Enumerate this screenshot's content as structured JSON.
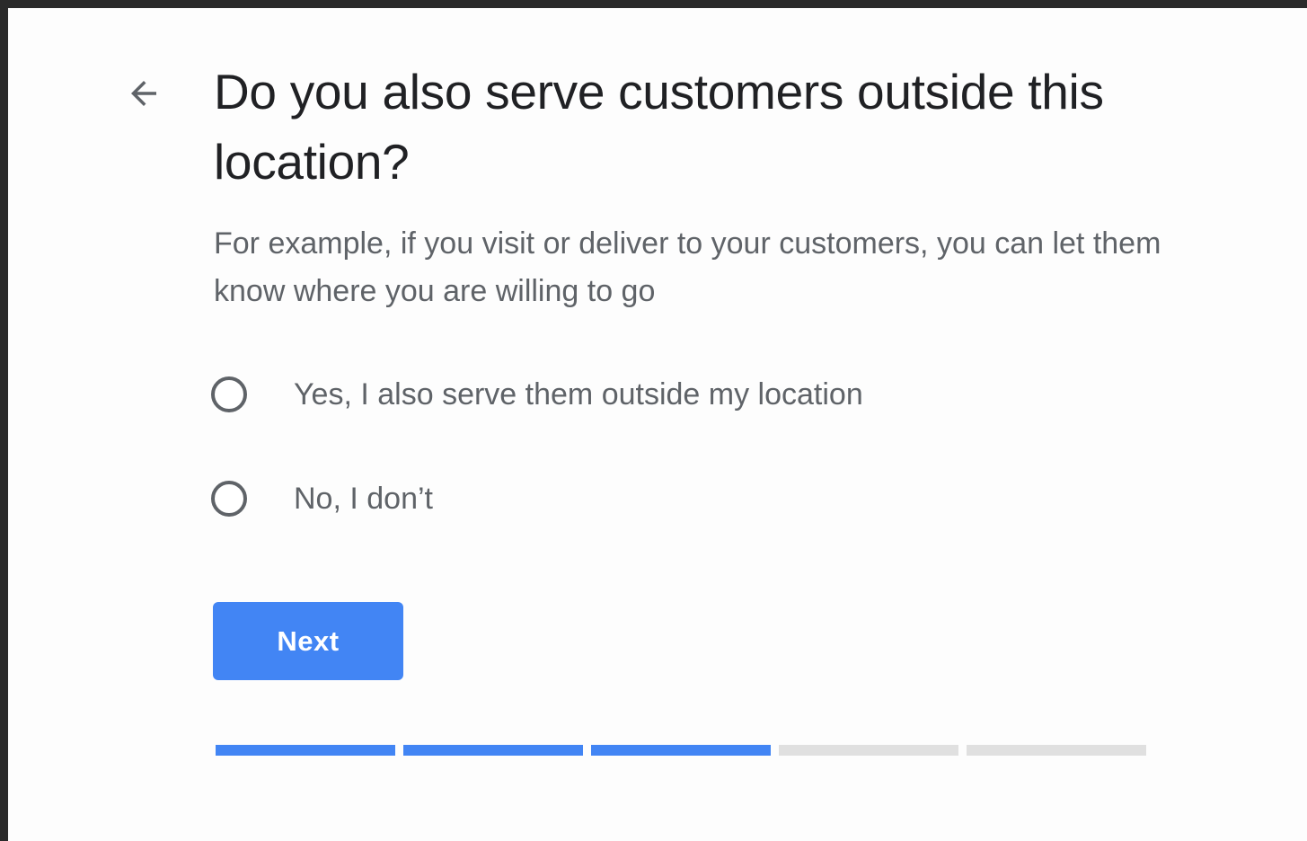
{
  "header": {
    "back_icon": "arrow-back-icon",
    "title": "Do you also serve customers outside this location?"
  },
  "subtitle": "For example, if you visit or deliver to your customers, you can let them know where you are willing to go",
  "options": [
    {
      "label": "Yes, I also serve them outside my location",
      "selected": false
    },
    {
      "label": "No, I don’t",
      "selected": false
    }
  ],
  "actions": {
    "next_label": "Next"
  },
  "progress": {
    "total_steps": 5,
    "completed_steps": 3,
    "active_color": "#4285f4",
    "inactive_color": "#e0e0e0"
  },
  "colors": {
    "accent": "#4285f4",
    "title_text": "#202124",
    "secondary_text": "#5f6368"
  }
}
